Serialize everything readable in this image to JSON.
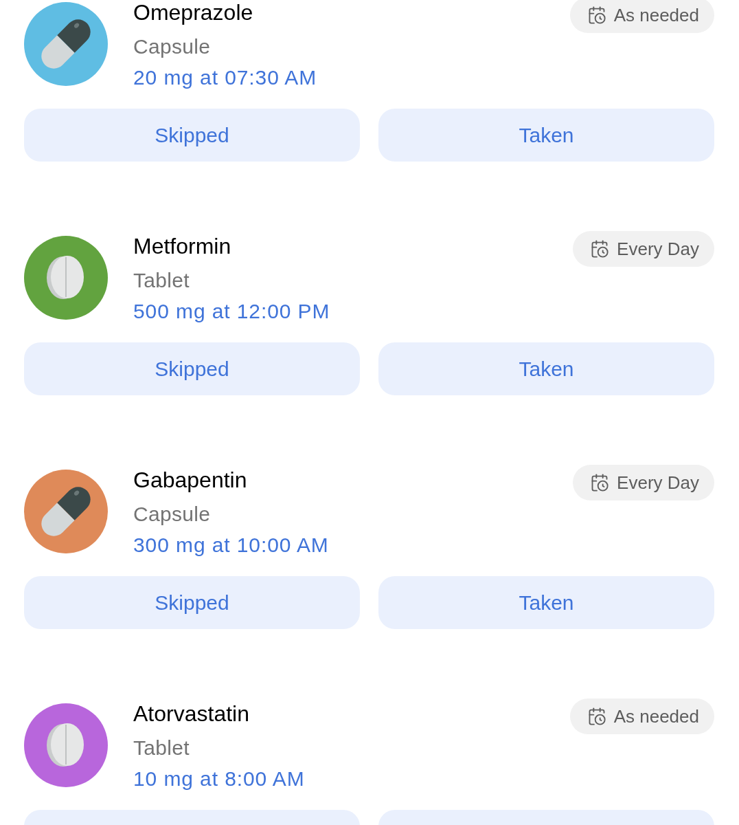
{
  "medications": [
    {
      "name": "Omeprazole",
      "form": "Capsule",
      "dose": "20 mg at 07:30 AM",
      "kind": "capsule",
      "color": "#5fbde3",
      "schedule": "As needed",
      "actions": [
        {
          "label": "Skipped",
          "selected": false
        },
        {
          "label": "Taken",
          "selected": false
        }
      ]
    },
    {
      "name": "Metformin",
      "form": "Tablet",
      "dose": "500 mg at 12:00 PM",
      "kind": "tablet",
      "color": "#62a33f",
      "schedule": "Every Day",
      "actions": [
        {
          "label": "Skipped",
          "selected": false
        },
        {
          "label": "Taken",
          "selected": false
        }
      ]
    },
    {
      "name": "Gabapentin",
      "form": "Capsule",
      "dose": "300 mg at 10:00 AM",
      "kind": "capsule",
      "color": "#df8a59",
      "schedule": "Every Day",
      "actions": [
        {
          "label": "Skipped",
          "selected": false
        },
        {
          "label": "Taken",
          "selected": false
        }
      ]
    },
    {
      "name": "Atorvastatin",
      "form": "Tablet",
      "dose": "10 mg at 8:00 AM",
      "kind": "tablet",
      "color": "#b866dc",
      "schedule": "As needed",
      "actions": [
        {
          "selected": false
        },
        {
          "selected": false
        }
      ]
    }
  ]
}
